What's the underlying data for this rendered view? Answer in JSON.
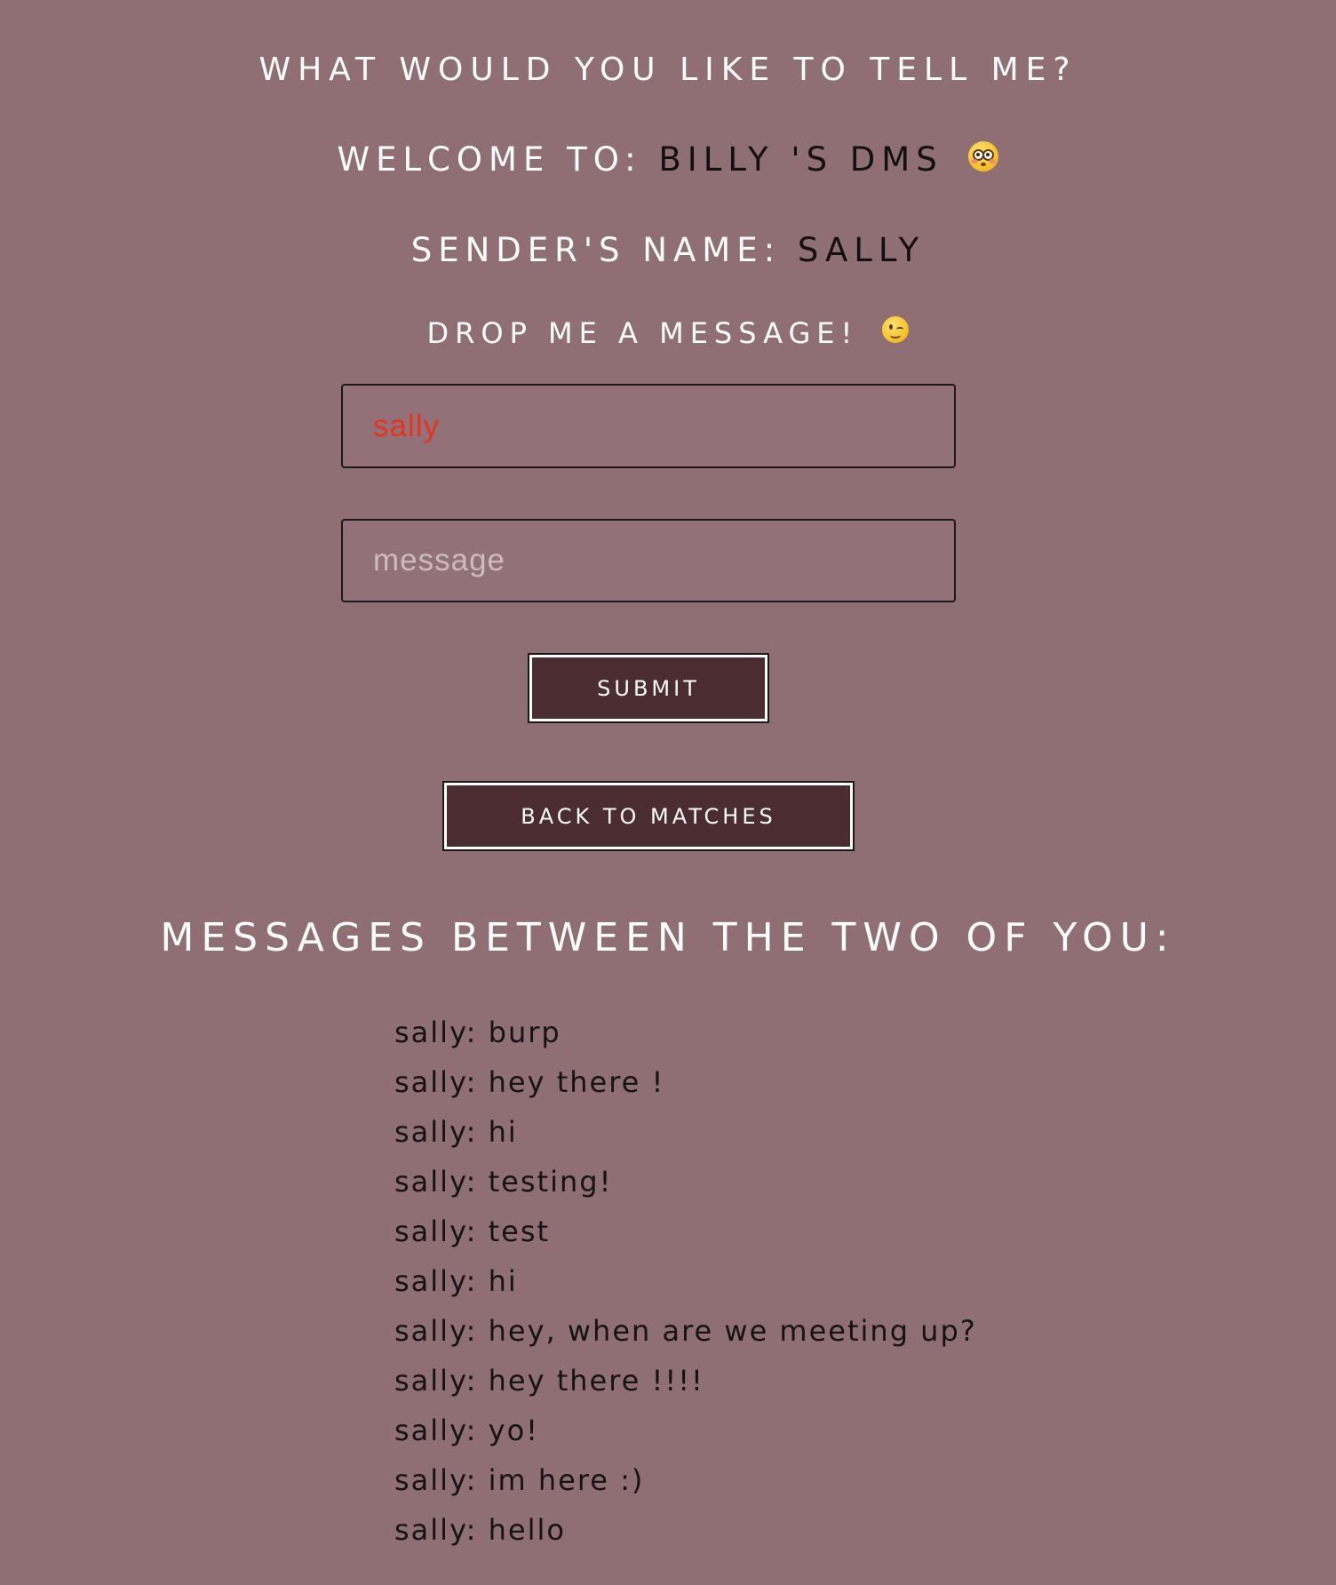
{
  "header": {
    "title": "WHAT WOULD YOU LIKE TO TELL ME?",
    "welcome_label": "WELCOME TO:",
    "welcome_value": "BILLY 'S DMS",
    "welcome_emoji": "flushed-face",
    "sender_label": "SENDER'S NAME:",
    "sender_value": "SALLY",
    "drop_label": "DROP ME A MESSAGE!",
    "drop_emoji": "winking-face"
  },
  "form": {
    "name_value": "sally",
    "message_placeholder": "message",
    "submit_label": "SUBMIT",
    "back_label": "BACK TO MATCHES"
  },
  "messages": {
    "heading": "MESSAGES BETWEEN THE TWO OF YOU:",
    "items": [
      "sally: burp",
      "sally: hey there !",
      "sally: hi",
      "sally: testing!",
      "sally: test",
      "sally: hi",
      "sally: hey, when are we meeting up?",
      "sally: hey there !!!!",
      "sally: yo!",
      "sally: im here :)",
      "sally: hello"
    ]
  },
  "colors": {
    "background": "#8f6e74",
    "button": "#4a2c31",
    "name_text": "#e8331c"
  }
}
